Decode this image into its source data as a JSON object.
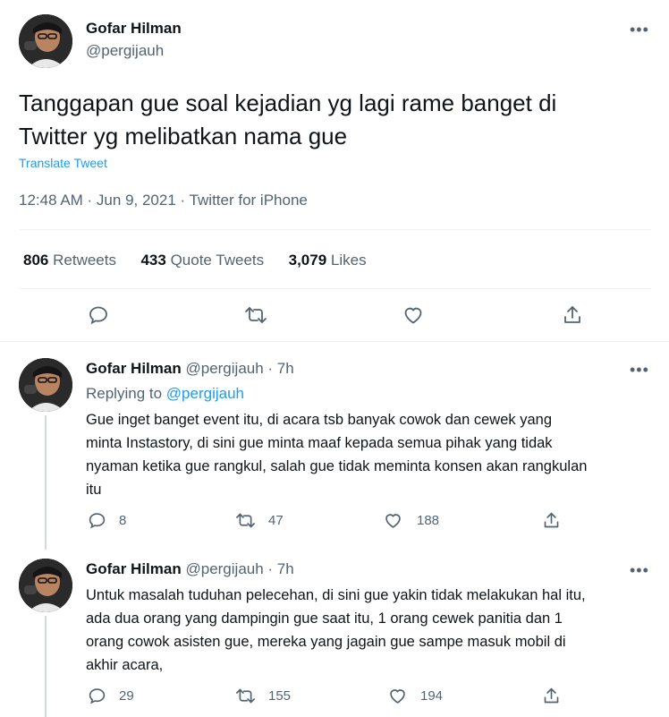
{
  "main_tweet": {
    "author_name": "Gofar Hilman",
    "handle": "@pergijauh",
    "text_line1": "Tanggapan gue soal kejadian yg lagi rame banget di",
    "text_line2": "Twitter yg melibatkan nama gue",
    "translate_label": "Translate Tweet",
    "timestamp": "12:48 AM · Jun 9, 2021 · Twitter for iPhone",
    "retweets_count": "806",
    "retweets_label": "Retweets",
    "quotes_count": "433",
    "quotes_label": "Quote Tweets",
    "likes_count": "3,079",
    "likes_label": "Likes"
  },
  "replies": [
    {
      "author_name": "Gofar Hilman",
      "handle": "@pergijauh",
      "time": "· 7h",
      "replying_prefix": "Replying to",
      "replying_handle": "@pergijauh",
      "lines": [
        "Gue inget banget event itu, di acara tsb banyak cowok dan cewek yang",
        "minta Instastory, di sini gue minta maaf kepada semua pihak yang tidak",
        "nyaman ketika gue rangkul, salah gue tidak meminta konsen akan rangkulan",
        "itu"
      ],
      "reply_count": "8",
      "retweet_count": "47",
      "like_count": "188"
    },
    {
      "author_name": "Gofar Hilman",
      "handle": "@pergijauh",
      "time": "· 7h",
      "lines": [
        "Untuk masalah tuduhan pelecehan, di sini gue yakin tidak melakukan hal itu,",
        "ada dua orang yang dampingin gue saat itu, 1 orang cewek panitia dan 1",
        "orang cowok asisten gue,  mereka yang jagain gue sampe masuk mobil di",
        "akhir acara,"
      ],
      "reply_count": "29",
      "retweet_count": "155",
      "like_count": "194"
    }
  ],
  "icons": {
    "more": "more-icon",
    "reply": "reply-icon",
    "retweet": "retweet-icon",
    "like": "heart-icon",
    "share": "share-icon"
  },
  "colors": {
    "text": "#0f1419",
    "muted": "#536471",
    "link": "#1d9bf0",
    "divider": "#eff3f4"
  }
}
